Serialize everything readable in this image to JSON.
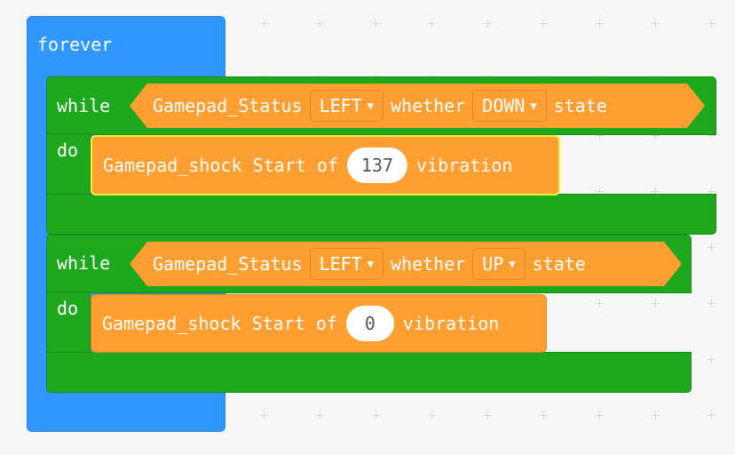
{
  "forever": {
    "label": "forever"
  },
  "loops": [
    {
      "keyword_while": "while",
      "keyword_do": "do",
      "condition": {
        "block": "Gamepad_Status",
        "key": "LEFT",
        "word_whether": "whether",
        "state": "DOWN",
        "word_state": "state"
      },
      "body": {
        "prefix": "Gamepad_shock Start of",
        "value": "137",
        "suffix": "vibration"
      }
    },
    {
      "keyword_while": "while",
      "keyword_do": "do",
      "condition": {
        "block": "Gamepad_Status",
        "key": "LEFT",
        "word_whether": "whether",
        "state": "UP",
        "word_state": "state"
      },
      "body": {
        "prefix": "Gamepad_shock Start of",
        "value": "0",
        "suffix": "vibration"
      }
    }
  ],
  "colors": {
    "forever": "#2f97ff",
    "loop": "#1ea81e",
    "gamepad": "#ff9f32",
    "selected": "#ffee3a",
    "canvas": "#f6f6f6"
  },
  "icons": {
    "dropdown": "caret-down-icon"
  }
}
